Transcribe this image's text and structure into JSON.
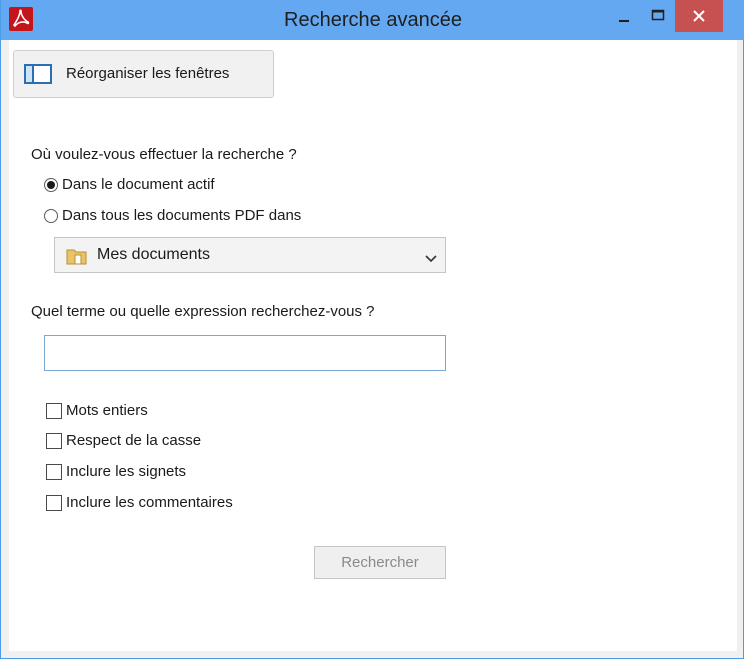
{
  "window": {
    "title": "Recherche avancée"
  },
  "toolbar": {
    "arrange_label": "Réorganiser les fenêtres"
  },
  "scope": {
    "question": "Où voulez-vous effectuer la recherche ?",
    "options": [
      {
        "label": "Dans le document actif",
        "checked": true
      },
      {
        "label": "Dans tous les documents PDF dans",
        "checked": false
      }
    ],
    "location": {
      "selected": "Mes documents",
      "icon": "folder-icon"
    }
  },
  "term": {
    "question": "Quel terme ou quelle expression recherchez-vous ?",
    "value": ""
  },
  "options": [
    {
      "label": "Mots entiers",
      "checked": false
    },
    {
      "label": "Respect de la casse",
      "checked": false
    },
    {
      "label": "Inclure les signets",
      "checked": false
    },
    {
      "label": "Inclure les commentaires",
      "checked": false
    }
  ],
  "actions": {
    "search_label": "Rechercher",
    "search_enabled": false
  },
  "colors": {
    "titlebar": "#63a8f0",
    "close": "#c75050",
    "app_icon": "#c4151b"
  }
}
